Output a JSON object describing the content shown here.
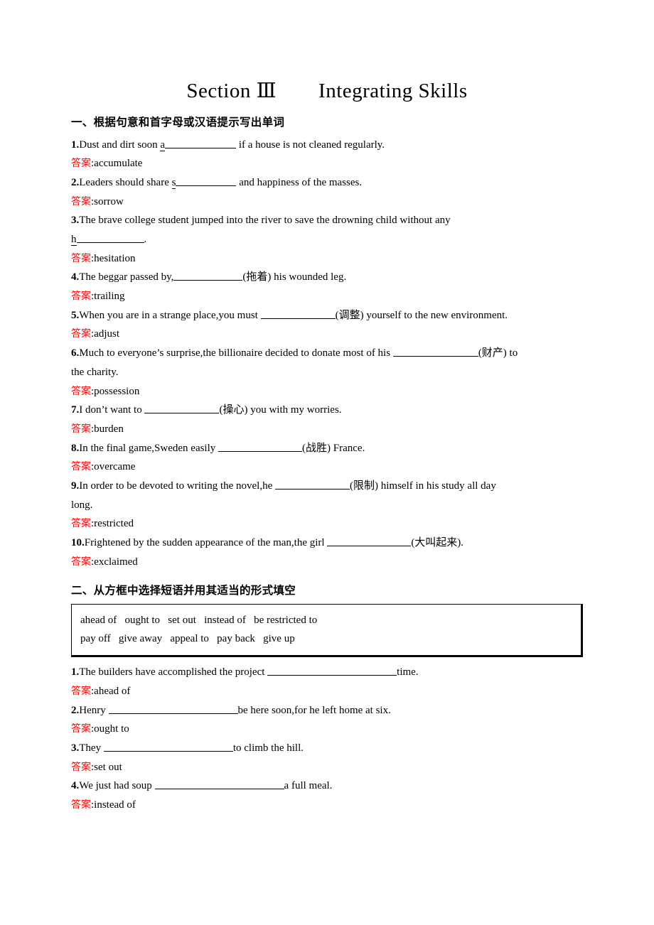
{
  "title": "Section Ⅲ　　Integrating Skills",
  "answer_label": "答案",
  "answer_sep": ":",
  "accent_red": "#ff0000",
  "section_one": {
    "heading": "一、根据句意和首字母或汉语提示写出单词",
    "items": [
      {
        "num": "1.",
        "pre": "Dust and dirt soon ",
        "seed": "a",
        "blank_width": 100,
        "post": " if a house is not cleaned regularly.",
        "answer": "accumulate"
      },
      {
        "num": "2.",
        "pre": "Leaders should share ",
        "seed": "s",
        "blank_width": 85,
        "post": " and happiness of the masses.",
        "answer": "sorrow"
      },
      {
        "num": "3.",
        "pre": "The brave college student jumped into the river to save the drowning child without any",
        "seed": "h",
        "blank_width": 95,
        "post": ".",
        "answer": "hesitation",
        "wrap": true
      },
      {
        "num": "4.",
        "pre": "The beggar passed by,",
        "seed": "",
        "blank_width": 97,
        "post": "(拖着) his wounded leg.",
        "answer": "trailing"
      },
      {
        "num": "5.",
        "pre": "When you are in a strange place,you must ",
        "seed": "",
        "blank_width": 105,
        "post": "(调整) yourself to the new environment.",
        "answer": "adjust"
      },
      {
        "num": "6.",
        "pre": "Much to everyone’s surprise,the billionaire decided to donate most of his ",
        "seed": "",
        "blank_width": 120,
        "post": "(财产) to",
        "post2": "the charity.",
        "answer": "possession"
      },
      {
        "num": "7.",
        "pre": "I don’t want to ",
        "seed": "",
        "blank_width": 105,
        "post": "(操心) you with my worries.",
        "answer": "burden"
      },
      {
        "num": "8.",
        "pre": "In the final game,Sweden easily ",
        "seed": "",
        "blank_width": 118,
        "post": "(战胜) France.",
        "answer": "overcame"
      },
      {
        "num": "9.",
        "pre": "In order to be devoted to writing the novel,he ",
        "seed": "",
        "blank_width": 105,
        "post": "(限制) himself in his study all day",
        "post2": "long.",
        "answer": "restricted"
      },
      {
        "num": "10.",
        "pre": "Frightened by the sudden appearance of the man,the girl ",
        "seed": "",
        "blank_width": 118,
        "post": "(大叫起来).",
        "answer": "exclaimed"
      }
    ]
  },
  "section_two": {
    "heading": "二、从方框中选择短语并用其适当的形式填空",
    "word_bank": {
      "row1": "ahead of   ought to   set out   instead of   be restricted to",
      "row2": "pay off   give away   appeal to   pay back   give up"
    },
    "items": [
      {
        "num": "1.",
        "pre": "The builders have accomplished the project ",
        "blank_width": 182,
        "post": "time.",
        "answer": "ahead of"
      },
      {
        "num": "2.",
        "pre": "Henry ",
        "blank_width": 182,
        "post": "be here soon,for he left home at six.",
        "answer": "ought to"
      },
      {
        "num": "3.",
        "pre": "They ",
        "blank_width": 182,
        "post": "to climb the hill.",
        "answer": "set out"
      },
      {
        "num": "4.",
        "pre": "We just had soup ",
        "blank_width": 182,
        "post": "a full meal.",
        "answer": "instead of"
      }
    ]
  }
}
